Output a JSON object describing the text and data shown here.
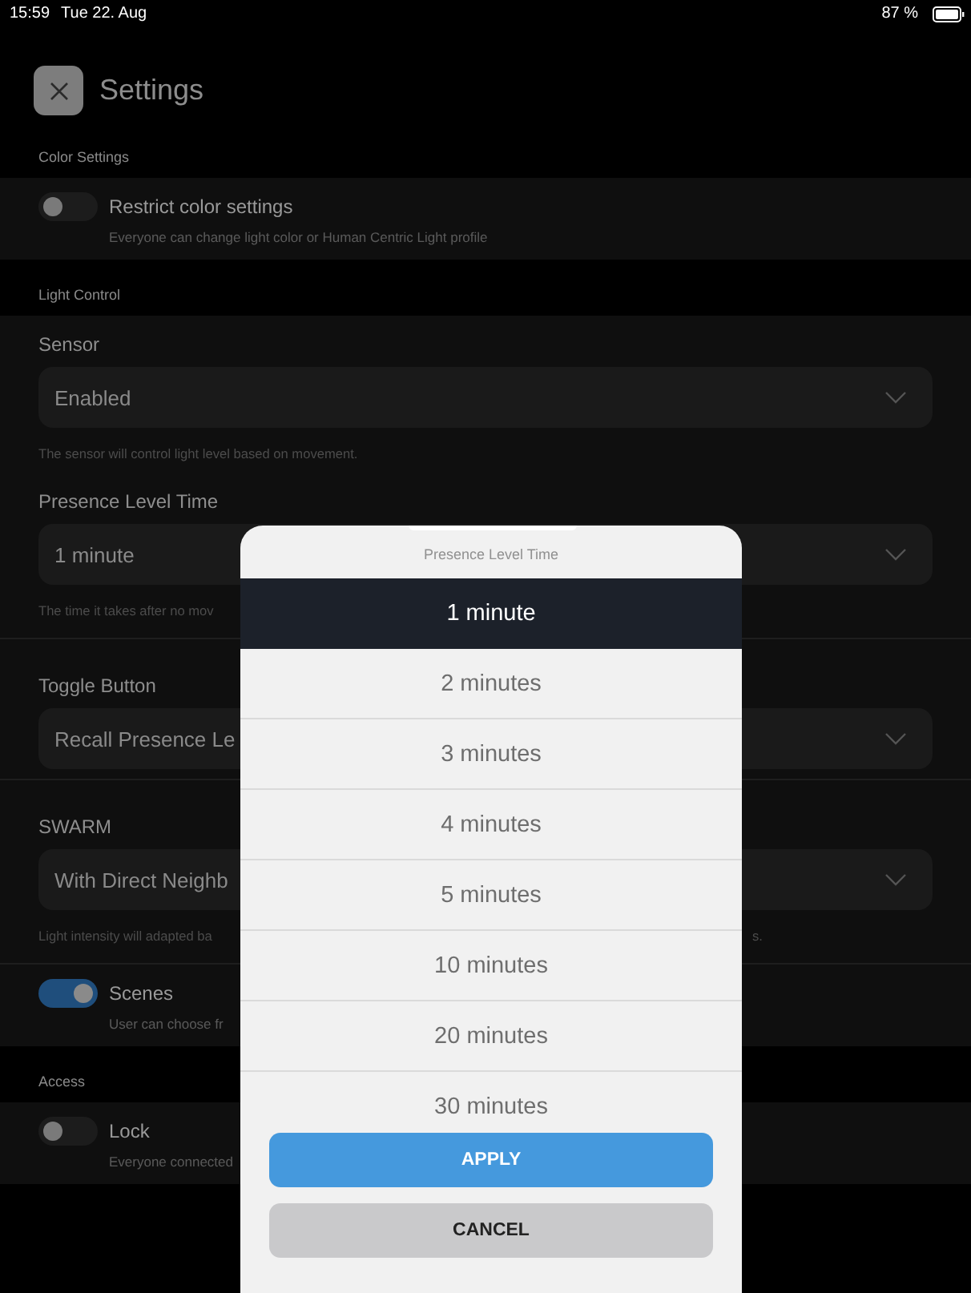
{
  "status_bar": {
    "time": "15:59",
    "date": "Tue 22. Aug",
    "battery": "87 %"
  },
  "header": {
    "title": "Settings"
  },
  "sections": [
    {
      "label": "Color Settings",
      "groups": [
        [
          {
            "kind": "toggle",
            "label": "Restrict color settings",
            "description": "Everyone can change light color or Human Centric Light profile",
            "on": false
          }
        ]
      ]
    },
    {
      "label": "Light Control",
      "groups": [
        [
          {
            "kind": "select",
            "label": "Sensor",
            "value": "Enabled",
            "helper": "The sensor will control light level based on movement."
          },
          {
            "kind": "select",
            "label": "Presence Level Time",
            "value": "1 minute",
            "helper": "The time it takes after no mov"
          }
        ],
        [
          {
            "kind": "select",
            "label": "Toggle Button",
            "value": "Recall Presence Le"
          }
        ],
        [
          {
            "kind": "select",
            "label": "SWARM",
            "value": "With Direct Neighb",
            "helper": "Light intensity will adapted ba",
            "helper_tail": "s."
          }
        ],
        [
          {
            "kind": "toggle",
            "label": "Scenes",
            "description": "User can choose fr",
            "on": true
          }
        ]
      ]
    },
    {
      "label": "Access",
      "groups": [
        [
          {
            "kind": "toggle",
            "label": "Lock",
            "description": "Everyone connected",
            "on": false
          }
        ]
      ]
    }
  ],
  "picker": {
    "title": "Presence Level Time",
    "options": [
      {
        "label": "1 minute",
        "selected": true
      },
      {
        "label": "2 minutes",
        "selected": false
      },
      {
        "label": "3 minutes",
        "selected": false
      },
      {
        "label": "4 minutes",
        "selected": false
      },
      {
        "label": "5 minutes",
        "selected": false
      },
      {
        "label": "10 minutes",
        "selected": false
      },
      {
        "label": "20 minutes",
        "selected": false
      },
      {
        "label": "30 minutes",
        "selected": false
      }
    ],
    "buttons": [
      {
        "label": "APPLY",
        "kind": "primary"
      },
      {
        "label": "CANCEL",
        "kind": "secondary"
      }
    ]
  }
}
